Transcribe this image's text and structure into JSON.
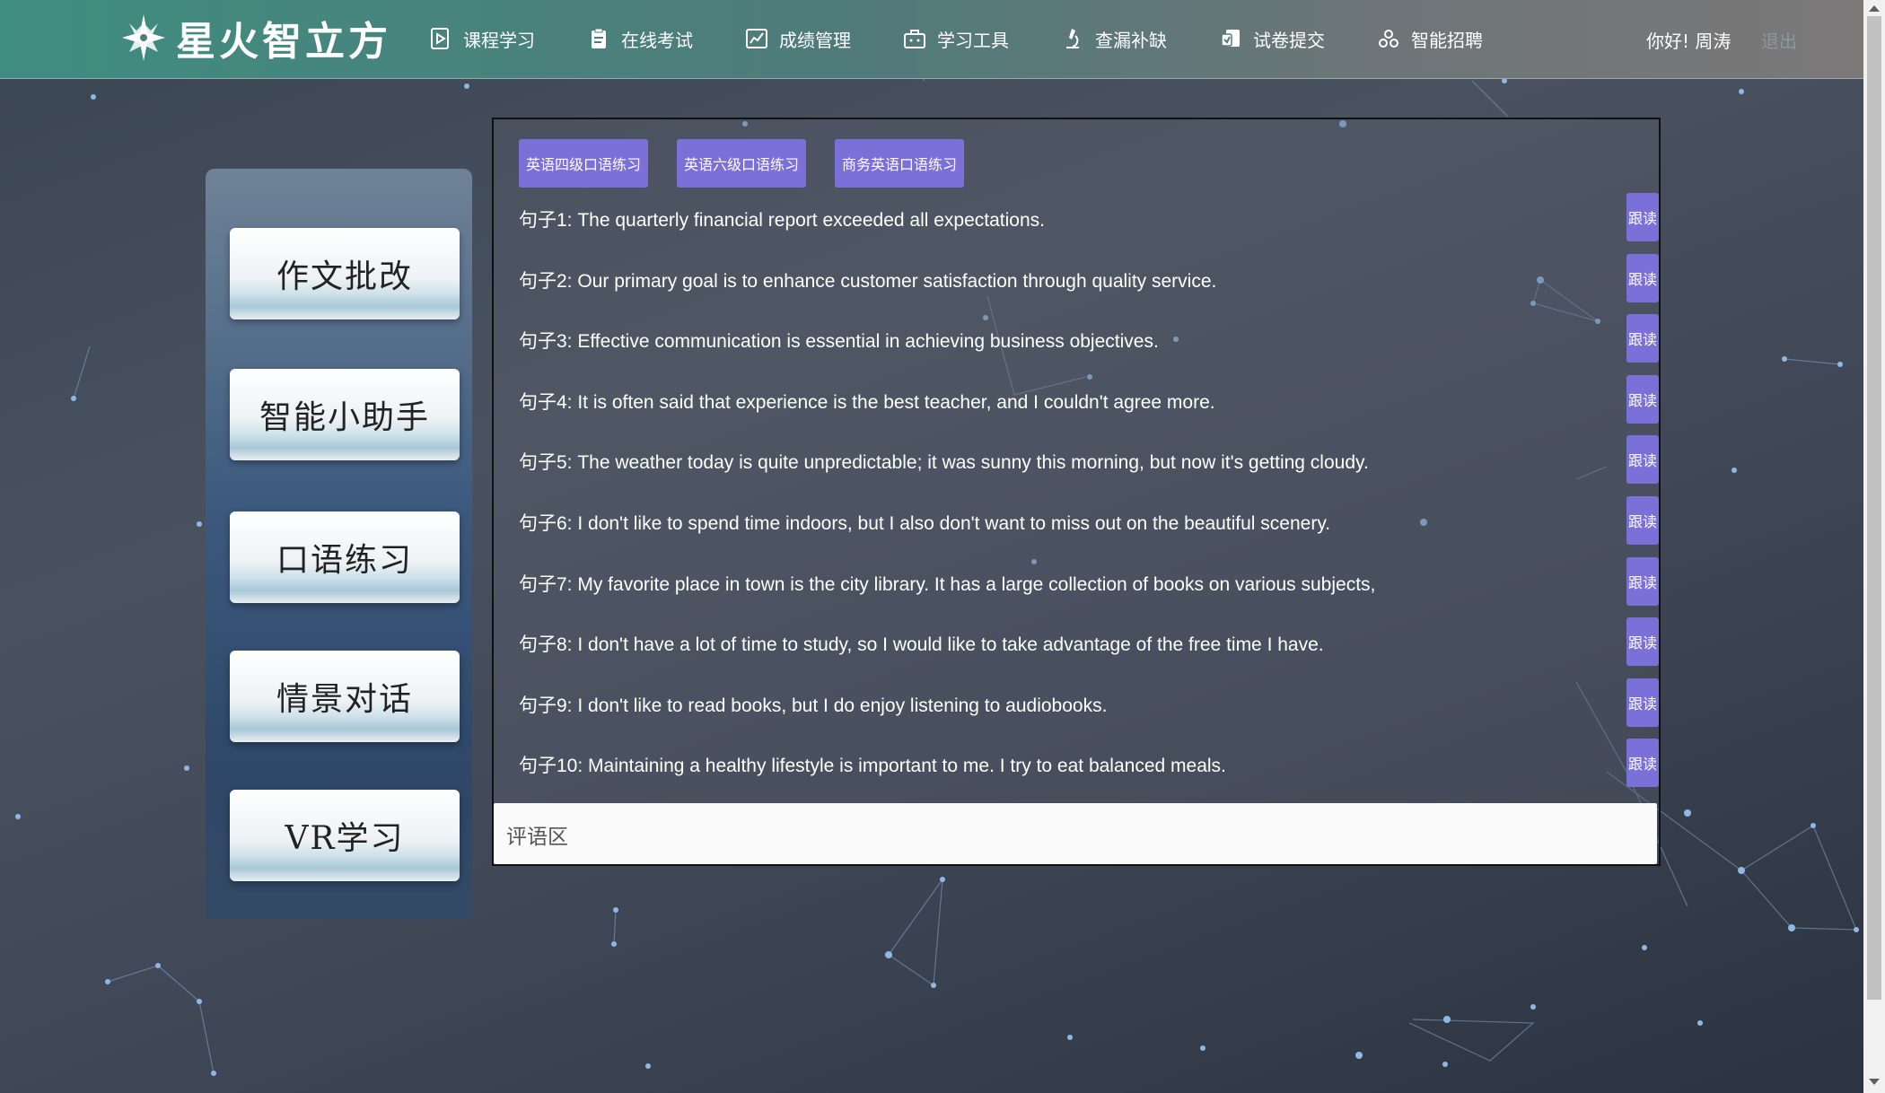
{
  "header": {
    "logo_text": "星火智立方",
    "nav": [
      {
        "label": "课程学习",
        "icon": "play-doc-icon"
      },
      {
        "label": "在线考试",
        "icon": "clipboard-icon"
      },
      {
        "label": "成绩管理",
        "icon": "chart-icon"
      },
      {
        "label": "学习工具",
        "icon": "toolbox-icon"
      },
      {
        "label": "查漏补缺",
        "icon": "microscope-icon"
      },
      {
        "label": "试卷提交",
        "icon": "submit-icon"
      },
      {
        "label": "智能招聘",
        "icon": "recruit-icon"
      }
    ],
    "greeting": "你好! 周涛",
    "logout": "退出"
  },
  "sidebar": {
    "items": [
      {
        "label": "作文批改"
      },
      {
        "label": "智能小助手"
      },
      {
        "label": "口语练习"
      },
      {
        "label": "情景对话"
      },
      {
        "label": "VR学习"
      }
    ]
  },
  "main": {
    "tabs": [
      {
        "label": "英语四级口语练习"
      },
      {
        "label": "英语六级口语练习"
      },
      {
        "label": "商务英语口语练习"
      }
    ],
    "follow_label": "跟读",
    "sentences": [
      {
        "text": "句子1: The quarterly financial report exceeded all expectations."
      },
      {
        "text": "句子2: Our primary goal is to enhance customer satisfaction through quality service."
      },
      {
        "text": "句子3: Effective communication is essential in achieving business objectives."
      },
      {
        "text": "句子4: It is often said that experience is the best teacher, and I couldn't agree more."
      },
      {
        "text": "句子5: The weather today is quite unpredictable; it was sunny this morning, but now it's getting cloudy."
      },
      {
        "text": "句子6: I don't like to spend time indoors, but I also don't want to miss out on the beautiful scenery."
      },
      {
        "text": "句子7: My favorite place in town is the city library. It has a large collection of books on various subjects,"
      },
      {
        "text": "句子8: I don't have a lot of time to study, so I would like to take advantage of the free time I have."
      },
      {
        "text": "句子9: I don't like to read books, but I do enjoy listening to audiobooks."
      },
      {
        "text": "句子10: Maintaining a healthy lifestyle is important to me. I try to eat balanced meals."
      }
    ],
    "comment_label": "评语区"
  },
  "colors": {
    "accent": "#7b70d8",
    "header_start": "#3f8d80",
    "header_end": "#7b7878"
  }
}
